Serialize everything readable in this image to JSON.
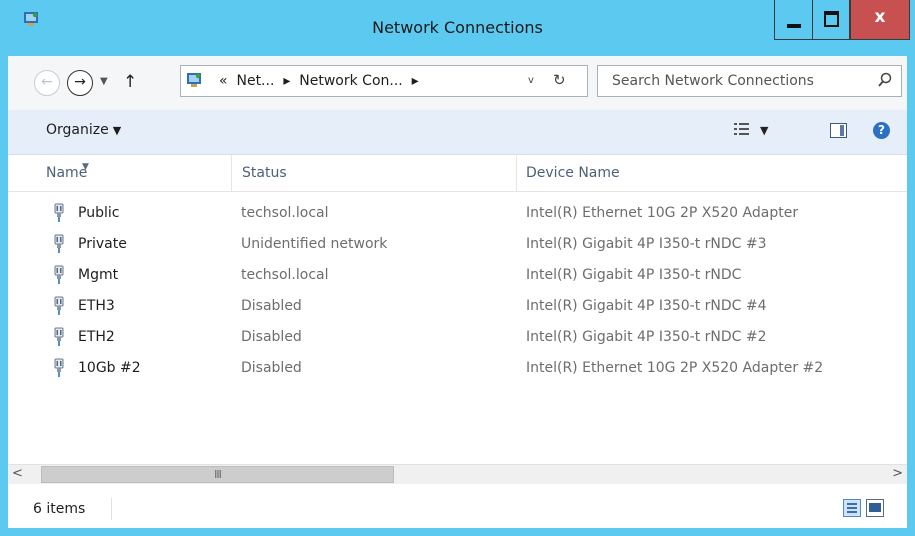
{
  "window": {
    "title": "Network Connections",
    "close_glyph": "x"
  },
  "nav": {
    "back_glyph": "←",
    "forward_glyph": "→",
    "recent_glyph": "▼",
    "up_glyph": "↑",
    "address": {
      "overflow": "«",
      "crumb1": "Net...",
      "crumb2": "Network Con...",
      "separator": "▸",
      "dropdown_glyph": "v",
      "refresh_glyph": "↻"
    },
    "search": {
      "placeholder": "Search Network Connections",
      "icon": "search-icon"
    }
  },
  "toolbar": {
    "organize_label": "Organize",
    "caret": "▼",
    "help_glyph": "?"
  },
  "columns": {
    "name": "Name",
    "status": "Status",
    "device": "Device Name"
  },
  "connections": [
    {
      "name": "Public",
      "status": "techsol.local",
      "device": "Intel(R) Ethernet 10G 2P X520 Adapter"
    },
    {
      "name": "Private",
      "status": "Unidentified network",
      "device": "Intel(R) Gigabit 4P I350-t rNDC #3"
    },
    {
      "name": "Mgmt",
      "status": "techsol.local",
      "device": "Intel(R) Gigabit 4P I350-t rNDC"
    },
    {
      "name": "ETH3",
      "status": "Disabled",
      "device": "Intel(R) Gigabit 4P I350-t rNDC #4"
    },
    {
      "name": "ETH2",
      "status": "Disabled",
      "device": "Intel(R) Gigabit 4P I350-t rNDC #2"
    },
    {
      "name": "10Gb #2",
      "status": "Disabled",
      "device": "Intel(R) Ethernet 10G 2P X520 Adapter #2"
    }
  ],
  "scrollbar": {
    "left_glyph": "<",
    "right_glyph": ">",
    "grip": "III"
  },
  "status": {
    "item_count": "6 items"
  },
  "colors": {
    "frame": "#5ccaf0",
    "close_button": "#c75050",
    "command_bar": "#e6eefa"
  }
}
